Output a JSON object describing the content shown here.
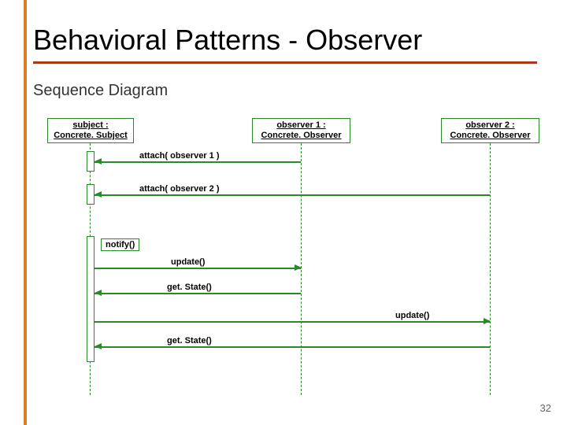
{
  "slide": {
    "title": "Behavioral Patterns - Observer",
    "subtitle": "Sequence Diagram",
    "page_number": "32"
  },
  "lifelines": {
    "subject": {
      "name": "subject :",
      "type": "Concrete. Subject"
    },
    "observer1": {
      "name": "observer 1 :",
      "type": "Concrete. Observer"
    },
    "observer2": {
      "name": "observer 2  :",
      "type": "Concrete. Observer"
    }
  },
  "messages": {
    "attach1": "attach( observer 1 )",
    "attach2": "attach( observer 2 )",
    "notify": "notify()",
    "update1": "update()",
    "get1": "get. State()",
    "update2": "update()",
    "get2": "get. State()"
  },
  "chart_data": {
    "type": "sequence-diagram",
    "participants": [
      {
        "id": "subject",
        "label": "subject : Concrete.Subject"
      },
      {
        "id": "observer1",
        "label": "observer1 : Concrete.Observer"
      },
      {
        "id": "observer2",
        "label": "observer2 : Concrete.Observer"
      }
    ],
    "interactions": [
      {
        "from": "observer1",
        "to": "subject",
        "label": "attach( observer1 )"
      },
      {
        "from": "observer2",
        "to": "subject",
        "label": "attach( observer2 )"
      },
      {
        "from": "subject",
        "to": "subject",
        "label": "notify()"
      },
      {
        "from": "subject",
        "to": "observer1",
        "label": "update()"
      },
      {
        "from": "observer1",
        "to": "subject",
        "label": "getState()"
      },
      {
        "from": "subject",
        "to": "observer2",
        "label": "update()"
      },
      {
        "from": "observer2",
        "to": "subject",
        "label": "getState()"
      }
    ]
  }
}
